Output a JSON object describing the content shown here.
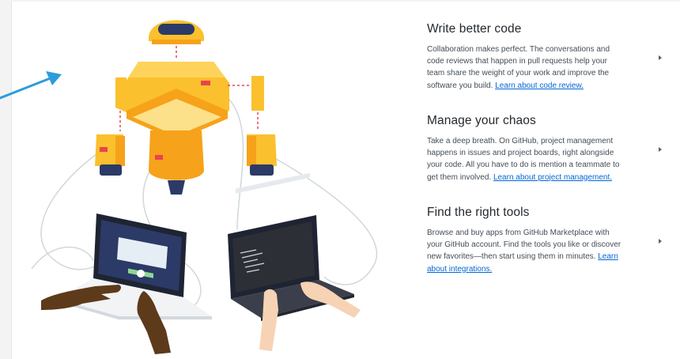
{
  "features": [
    {
      "title": "Write better code",
      "body": "Collaboration makes perfect. The conversations and code reviews that happen in pull requests help your team share the weight of your work and improve the software you build. ",
      "link": "Learn about code review."
    },
    {
      "title": "Manage your chaos",
      "body": "Take a deep breath. On GitHub, project management happens in issues and project boards, right alongside your code. All you have to do is mention a teammate to get them involved. ",
      "link": "Learn about project management."
    },
    {
      "title": "Find the right tools",
      "body": "Browse and buy apps from GitHub Marketplace with your GitHub account. Find the tools you like or discover new favorites—then start using them in minutes. ",
      "link": "Learn about integrations."
    }
  ],
  "icons": {
    "pointer": "pointer-arrow-icon",
    "expand": "chevron-right-icon"
  },
  "colors": {
    "robot_yellow": "#fbc02d",
    "robot_orange": "#f6a21a",
    "robot_navy": "#2b3a67",
    "link_blue": "#0366d6",
    "pointer_blue": "#2d9cdb",
    "connector_red": "#e8434f"
  }
}
